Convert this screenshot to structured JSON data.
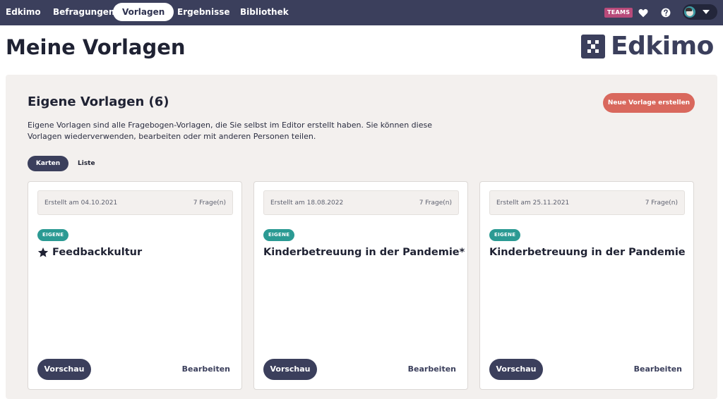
{
  "nav": {
    "brand": "Edkimo",
    "items": [
      {
        "label": "Befragungen"
      },
      {
        "label": "Vorlagen"
      },
      {
        "label": "Ergebnisse"
      },
      {
        "label": "Bibliothek"
      }
    ],
    "teams_badge": "TEAMS",
    "icons": [
      "heart-icon",
      "help-icon",
      "avatar",
      "chevron-down-icon"
    ]
  },
  "page": {
    "title": "Meine Vorlagen",
    "logo_text": "Edkimo"
  },
  "section": {
    "title": "Eigene Vorlagen (6)",
    "create_button": "Neue Vorlage erstellen",
    "description": "Eigene Vorlagen sind alle Fragebogen-Vorlagen, die Sie selbst im Editor erstellt haben. Sie können diese Vorlagen wiederverwenden, bearbeiten oder mit anderen Personen teilen.",
    "view_toggle": {
      "active": "Karten",
      "inactive": "Liste"
    }
  },
  "cards": [
    {
      "created": "Erstellt am 04.10.2021",
      "questions": "7 Frage(n)",
      "tag": "EIGENE",
      "title": "Feedbackkultur",
      "starred": true,
      "preview": "Vorschau",
      "edit": "Bearbeiten"
    },
    {
      "created": "Erstellt am 18.08.2022",
      "questions": "7 Frage(n)",
      "tag": "EIGENE",
      "title": "Kinderbetreuung in der Pandemie*",
      "starred": false,
      "preview": "Vorschau",
      "edit": "Bearbeiten"
    },
    {
      "created": "Erstellt am 25.11.2021",
      "questions": "7 Frage(n)",
      "tag": "EIGENE",
      "title": "Kinderbetreuung in der Pandemie",
      "starred": false,
      "preview": "Vorschau",
      "edit": "Bearbeiten"
    }
  ],
  "colors": {
    "nav_bg": "#3b3f5c",
    "accent_red": "#d9685d",
    "tag_teal": "#2b9a93",
    "teams_pink": "#b84a7a",
    "panel_bg": "#f3f0ee"
  }
}
